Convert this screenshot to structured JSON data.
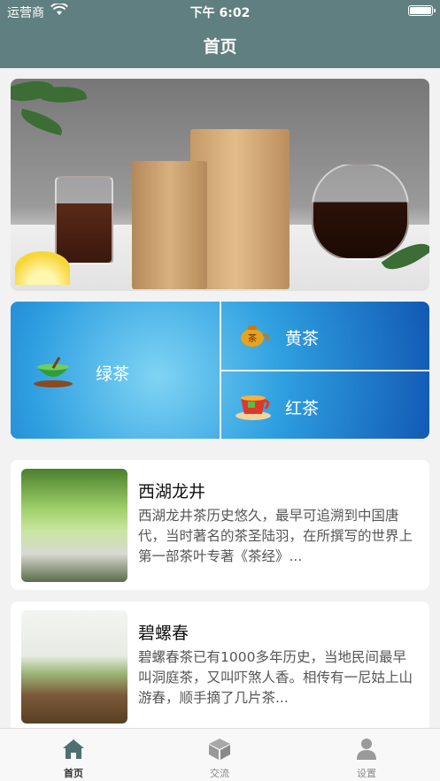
{
  "status_bar": {
    "carrier": "运营商",
    "time": "下午 6:02"
  },
  "nav": {
    "title": "首页"
  },
  "categories": [
    {
      "label": "绿茶",
      "icon": "green-tea-bowl-icon"
    },
    {
      "label": "黄茶",
      "icon": "yellow-tea-pot-icon"
    },
    {
      "label": "红茶",
      "icon": "red-tea-cup-icon"
    }
  ],
  "cards": [
    {
      "title": "西湖龙井",
      "desc": "西湖龙井茶历史悠久，最早可追溯到中国唐代，当时著名的茶圣陆羽，在所撰写的世界上第一部茶叶专著《茶经》..."
    },
    {
      "title": "碧螺春",
      "desc": "碧螺春茶已有1000多年历史，当地民间最早叫洞庭茶，又叫吓煞人香。相传有一尼姑上山游春，顺手摘了几片茶..."
    }
  ],
  "tabs": [
    {
      "label": "首页",
      "icon": "home-icon"
    },
    {
      "label": "交流",
      "icon": "cube-icon"
    },
    {
      "label": "设置",
      "icon": "person-icon"
    }
  ],
  "colors": {
    "nav": "#5f7f80",
    "tab_active": "#4f7071",
    "tab_inactive": "#999999"
  }
}
